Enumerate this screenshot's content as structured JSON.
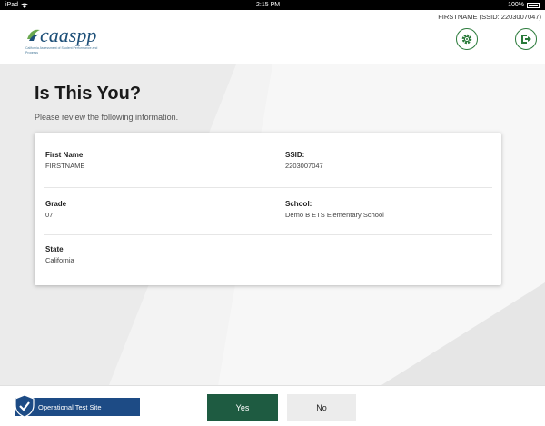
{
  "status_bar": {
    "carrier": "iPad",
    "time": "2:15 PM",
    "battery": "100%"
  },
  "header": {
    "user_label": "FIRSTNAME (SSID: 2203007047)",
    "logo_text": "caaspp",
    "logo_sub": "California Assessment of Student Performance and Progress",
    "settings_icon": "gear-icon",
    "logout_icon": "logout-icon"
  },
  "page": {
    "title": "Is This You?",
    "subtitle": "Please review the following information."
  },
  "info": {
    "first_name_label": "First Name",
    "first_name_value": "FIRSTNAME",
    "ssid_label": "SSID:",
    "ssid_value": "2203007047",
    "grade_label": "Grade",
    "grade_value": "07",
    "school_label": "School:",
    "school_value": "Demo B ETS Elementary School",
    "state_label": "State",
    "state_value": "California"
  },
  "footer": {
    "site_label": "Operational Test Site",
    "yes_label": "Yes",
    "no_label": "No"
  },
  "colors": {
    "brand_blue": "#1d4f78",
    "accent_green": "#2a7a3a",
    "yes_button": "#1e5b41",
    "site_badge": "#1d4b85"
  }
}
